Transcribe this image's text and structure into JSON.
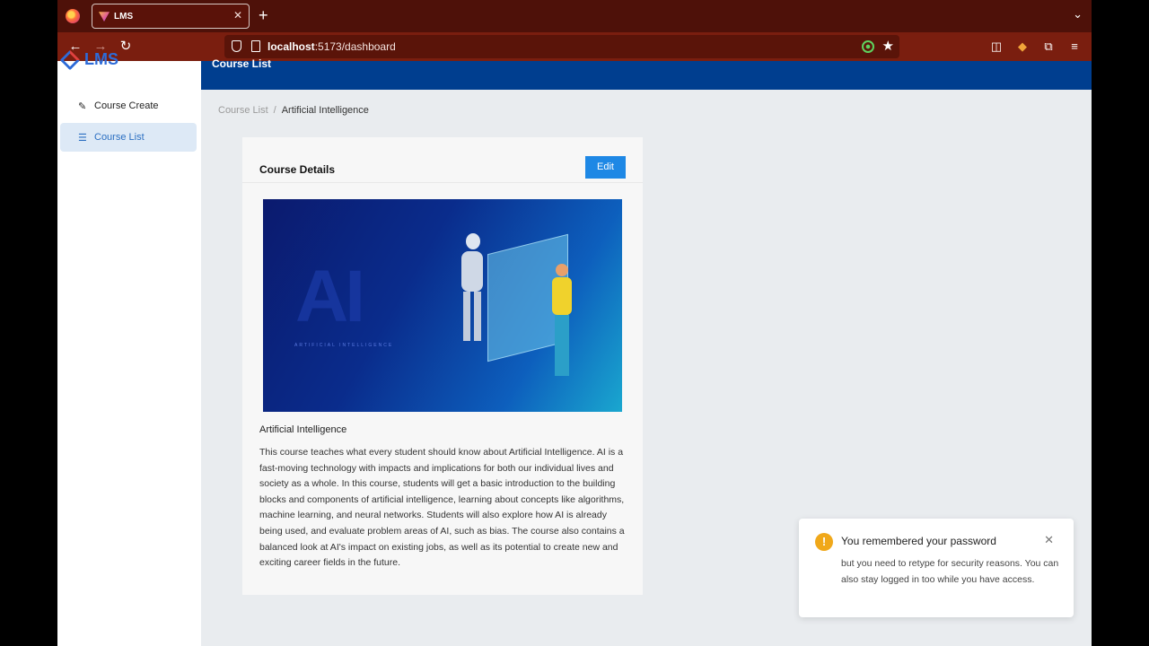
{
  "browser": {
    "tab_title": "LMS",
    "url_host": "localhost",
    "url_rest": ":5173/dashboard"
  },
  "sidebar": {
    "logo": "LMS",
    "items": [
      {
        "label": "Course Create",
        "icon": "pencil-icon"
      },
      {
        "label": "Course List",
        "icon": "list-icon",
        "active": true
      }
    ]
  },
  "header": {
    "title": "Course List"
  },
  "breadcrumb": {
    "parent": "Course List",
    "separator": "/",
    "current": "Artificial Intelligence"
  },
  "card": {
    "title": "Course Details",
    "edit_label": "Edit",
    "image": {
      "text": "AI",
      "subtext": "ARTIFICIAL INTELLIGENCE"
    },
    "course_name": "Artificial Intelligence",
    "description": "This course teaches what every student should know about Artificial Intelligence. AI is a fast-moving technology with impacts and implications for both our individual lives and society as a whole. In this course, students will get a basic introduction to the building blocks and components of artificial intelligence, learning about concepts like algorithms, machine learning, and neural networks. Students will also explore how AI is already being used, and evaluate problem areas of AI, such as bias. The course also contains a balanced look at AI's impact on existing jobs, as well as its potential to create new and exciting career fields in the future."
  },
  "toast": {
    "title": "You remembered your password",
    "body": "but you need to retype for security reasons. You can also stay logged in too while you have access.",
    "icon": "warning-icon"
  },
  "colors": {
    "header": "#003e8f",
    "edit_button": "#1e88e5",
    "active_sidebar_bg": "#dde9f6",
    "browser_tabbar": "#4e1109",
    "browser_navbar": "#7a1e0f"
  }
}
